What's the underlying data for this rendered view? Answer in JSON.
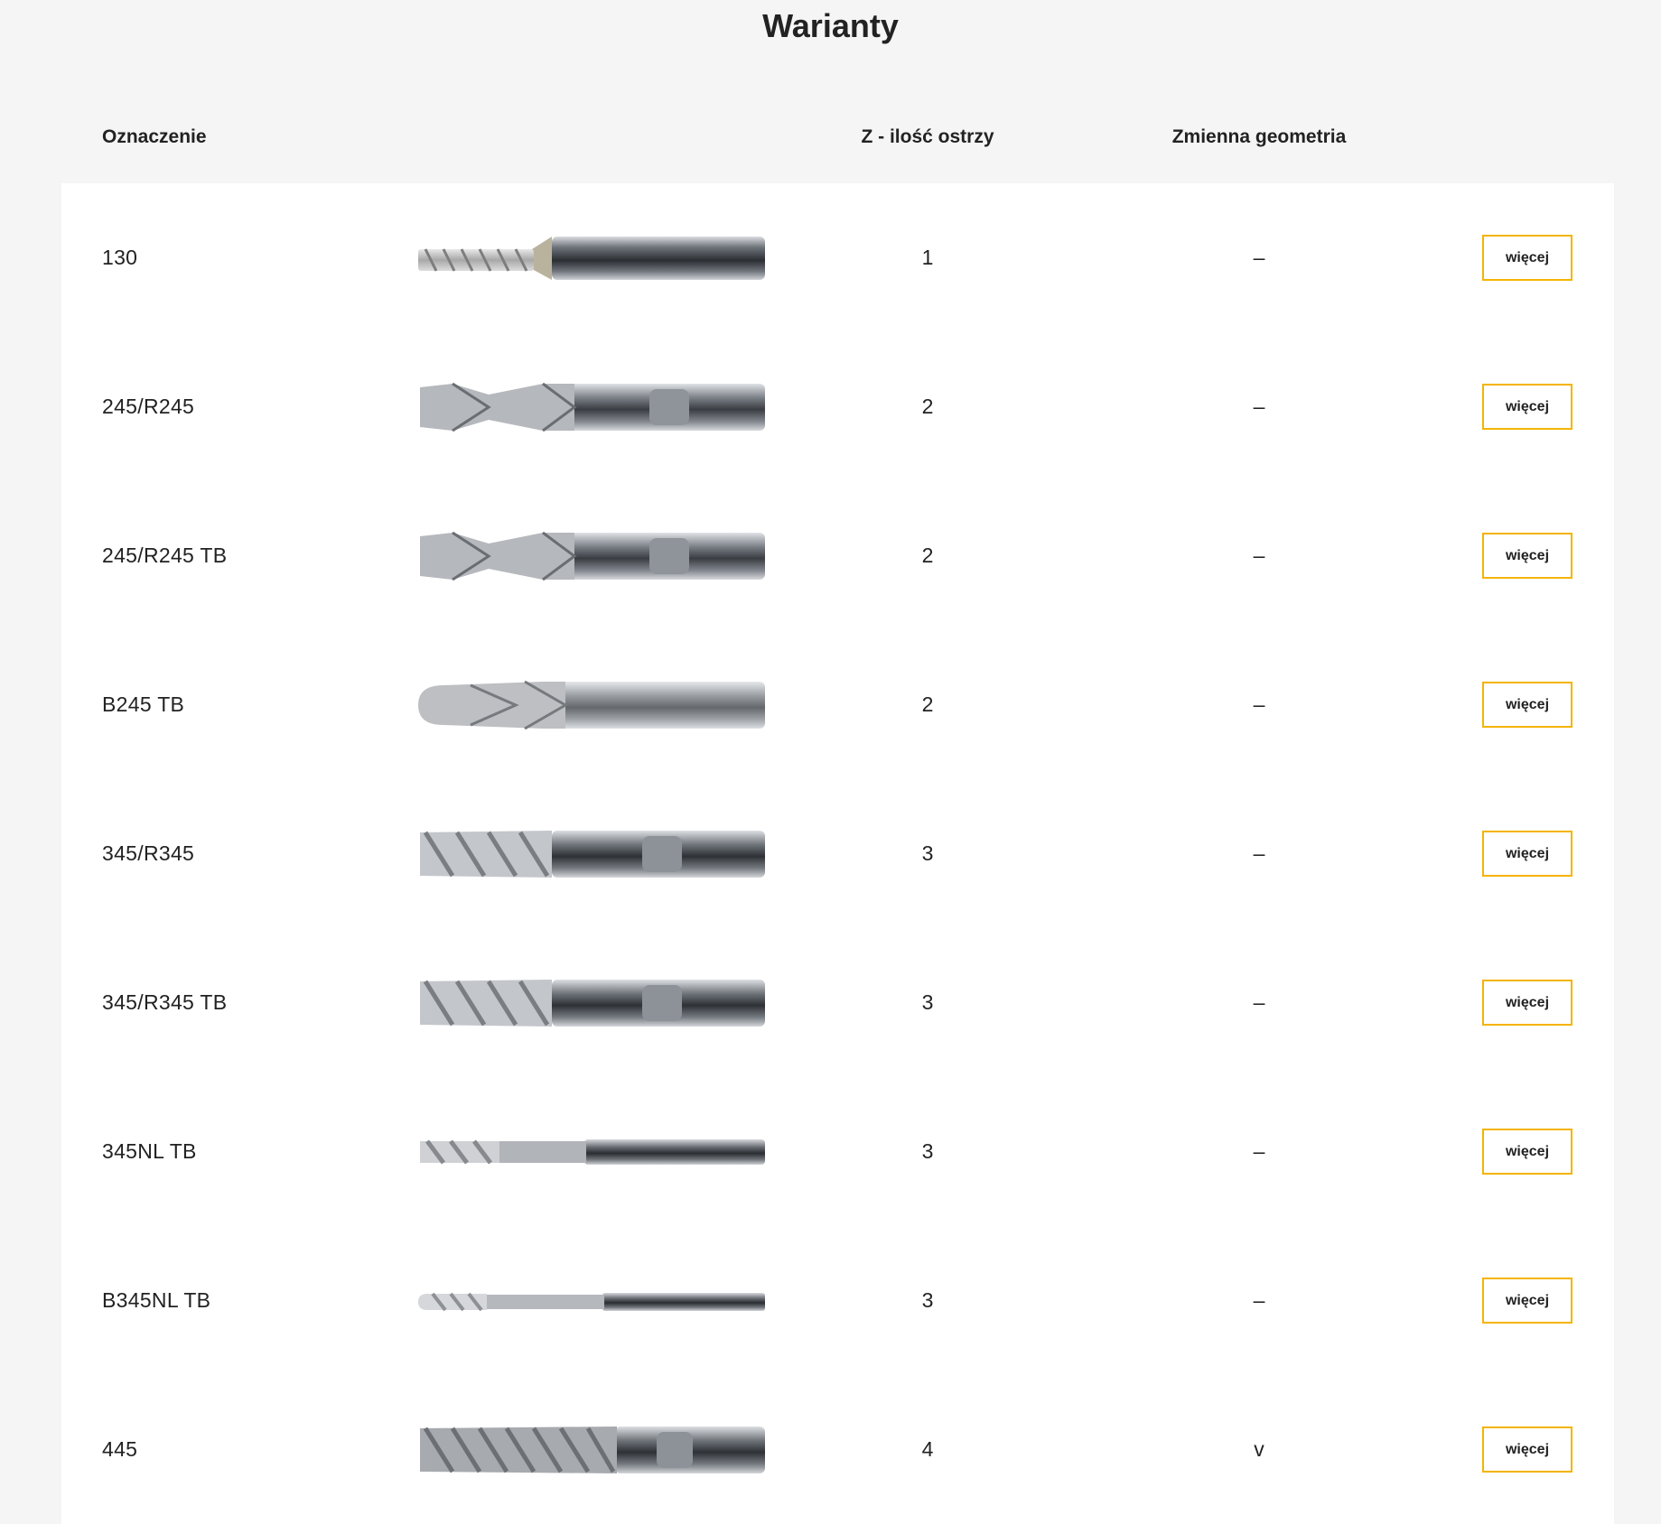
{
  "section": {
    "title": "Warianty"
  },
  "columns": {
    "oznaczenie": "Oznaczenie",
    "z": "Z - ilość ostrzy",
    "geometria": "Zmienna geometria"
  },
  "button_label": "więcej",
  "accent_color": "#f4b400",
  "rows": [
    {
      "name": "130",
      "z": "1",
      "geometria": "–",
      "image": "end-mill-1-flute-icon",
      "button": "więcej"
    },
    {
      "name": "245/R245",
      "z": "2",
      "geometria": "–",
      "image": "end-mill-2-flute-weldon-icon",
      "button": "więcej"
    },
    {
      "name": "245/R245 TB",
      "z": "2",
      "geometria": "–",
      "image": "end-mill-2-flute-weldon-icon",
      "button": "więcej"
    },
    {
      "name": "B245 TB",
      "z": "2",
      "geometria": "–",
      "image": "ball-end-mill-2-flute-icon",
      "button": "więcej"
    },
    {
      "name": "345/R345",
      "z": "3",
      "geometria": "–",
      "image": "end-mill-3-flute-weldon-icon",
      "button": "więcej"
    },
    {
      "name": "345/R345 TB",
      "z": "3",
      "geometria": "–",
      "image": "end-mill-3-flute-weldon-icon",
      "button": "więcej"
    },
    {
      "name": "345NL TB",
      "z": "3",
      "geometria": "–",
      "image": "end-mill-3-flute-long-neck-icon",
      "button": "więcej"
    },
    {
      "name": "B345NL TB",
      "z": "3",
      "geometria": "–",
      "image": "ball-end-mill-3-flute-long-neck-icon",
      "button": "więcej"
    },
    {
      "name": "445",
      "z": "4",
      "geometria": "v",
      "image": "end-mill-4-flute-weldon-icon",
      "button": "więcej"
    }
  ]
}
